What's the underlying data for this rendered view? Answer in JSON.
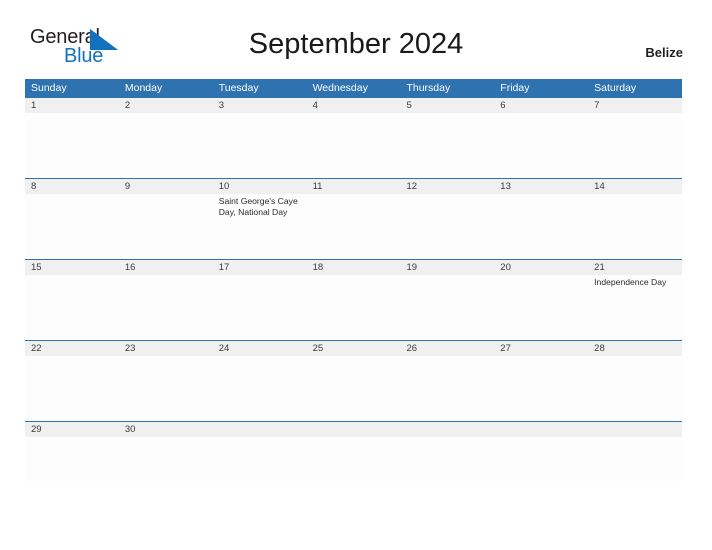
{
  "brand": {
    "word_one": "General",
    "word_two": "Blue",
    "flag_icon": "triangle-flag-icon",
    "blue": "#1471be"
  },
  "header": {
    "title": "September 2024",
    "country": "Belize",
    "header_blue": "#2e72b0",
    "band_gray": "#f0f0f0"
  },
  "calendar": {
    "weekdays": [
      "Sunday",
      "Monday",
      "Tuesday",
      "Wednesday",
      "Thursday",
      "Friday",
      "Saturday"
    ],
    "weeks": [
      {
        "days": [
          {
            "num": "1",
            "event": ""
          },
          {
            "num": "2",
            "event": ""
          },
          {
            "num": "3",
            "event": ""
          },
          {
            "num": "4",
            "event": ""
          },
          {
            "num": "5",
            "event": ""
          },
          {
            "num": "6",
            "event": ""
          },
          {
            "num": "7",
            "event": ""
          }
        ]
      },
      {
        "days": [
          {
            "num": "8",
            "event": ""
          },
          {
            "num": "9",
            "event": ""
          },
          {
            "num": "10",
            "event": "Saint George's Caye Day, National Day"
          },
          {
            "num": "11",
            "event": ""
          },
          {
            "num": "12",
            "event": ""
          },
          {
            "num": "13",
            "event": ""
          },
          {
            "num": "14",
            "event": ""
          }
        ]
      },
      {
        "days": [
          {
            "num": "15",
            "event": ""
          },
          {
            "num": "16",
            "event": ""
          },
          {
            "num": "17",
            "event": ""
          },
          {
            "num": "18",
            "event": ""
          },
          {
            "num": "19",
            "event": ""
          },
          {
            "num": "20",
            "event": ""
          },
          {
            "num": "21",
            "event": "Independence Day"
          }
        ]
      },
      {
        "days": [
          {
            "num": "22",
            "event": ""
          },
          {
            "num": "23",
            "event": ""
          },
          {
            "num": "24",
            "event": ""
          },
          {
            "num": "25",
            "event": ""
          },
          {
            "num": "26",
            "event": ""
          },
          {
            "num": "27",
            "event": ""
          },
          {
            "num": "28",
            "event": ""
          }
        ]
      },
      {
        "days": [
          {
            "num": "29",
            "event": ""
          },
          {
            "num": "30",
            "event": ""
          },
          {
            "num": "",
            "event": ""
          },
          {
            "num": "",
            "event": ""
          },
          {
            "num": "",
            "event": ""
          },
          {
            "num": "",
            "event": ""
          },
          {
            "num": "",
            "event": ""
          }
        ]
      }
    ]
  }
}
